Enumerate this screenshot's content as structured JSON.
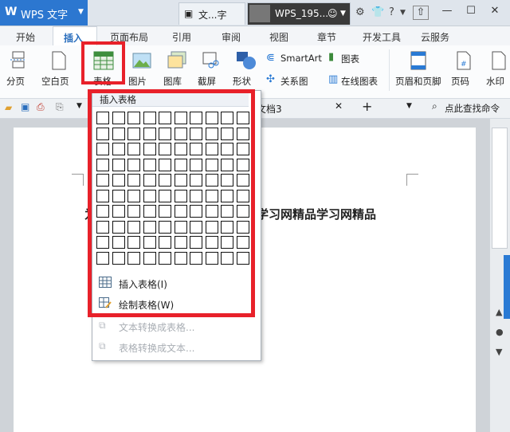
{
  "titlebar": {
    "app_logo": "W",
    "app_name": "WPS 文字",
    "tabs": [
      "文...字",
      "WPS_195..."
    ],
    "icons": [
      "doc-icon",
      "smile-icon",
      "settings-icon",
      "shirt-icon",
      "help-icon",
      "minimize-to-tray-icon",
      "upload-icon",
      "minimize-icon",
      "maximize-icon",
      "close-icon"
    ],
    "help_label": "?"
  },
  "ribbon_tabs": [
    "开始",
    "插入",
    "页面布局",
    "引用",
    "审阅",
    "视图",
    "章节",
    "开发工具",
    "云服务"
  ],
  "ribbon": {
    "buttons": [
      {
        "label": "分页",
        "icon": "page-break-icon"
      },
      {
        "label": "空白页",
        "icon": "blank-page-icon"
      },
      {
        "label": "表格",
        "icon": "table-icon"
      },
      {
        "label": "图片",
        "icon": "picture-icon"
      },
      {
        "label": "图库",
        "icon": "gallery-icon"
      },
      {
        "label": "截屏",
        "icon": "screenshot-icon"
      },
      {
        "label": "形状",
        "icon": "shape-icon"
      },
      {
        "label": "关系图",
        "icon": "relation-icon"
      },
      {
        "label": "SmartArt",
        "icon": "smartart-icon"
      },
      {
        "label": "图表",
        "icon": "chart-icon"
      },
      {
        "label": "在线图表",
        "icon": "online-chart-icon"
      },
      {
        "label": "页眉和页脚",
        "icon": "header-footer-icon"
      },
      {
        "label": "页码",
        "icon": "page-number-icon"
      },
      {
        "label": "水印",
        "icon": "watermark-icon"
      }
    ]
  },
  "quickbar": {
    "doc_tab": "文档3",
    "search_label": "点此查找命令"
  },
  "document": {
    "line1_visible": "学习网精品学习网精品",
    "left_fragment": "为"
  },
  "dropdown": {
    "header": "插入表格",
    "grid_rows": 10,
    "grid_cols": 10,
    "items": [
      {
        "label": "插入表格(I)",
        "icon": "insert-table-icon",
        "enabled": true
      },
      {
        "label": "绘制表格(W)",
        "icon": "draw-table-icon",
        "enabled": true
      },
      {
        "label": "文本转换成表格...",
        "icon": "text-to-table-icon",
        "enabled": false
      },
      {
        "label": "表格转换成文本...",
        "icon": "table-to-text-icon",
        "enabled": false
      }
    ]
  },
  "colors": {
    "highlight": "#e8212a",
    "app_blue": "#2c77d0"
  }
}
